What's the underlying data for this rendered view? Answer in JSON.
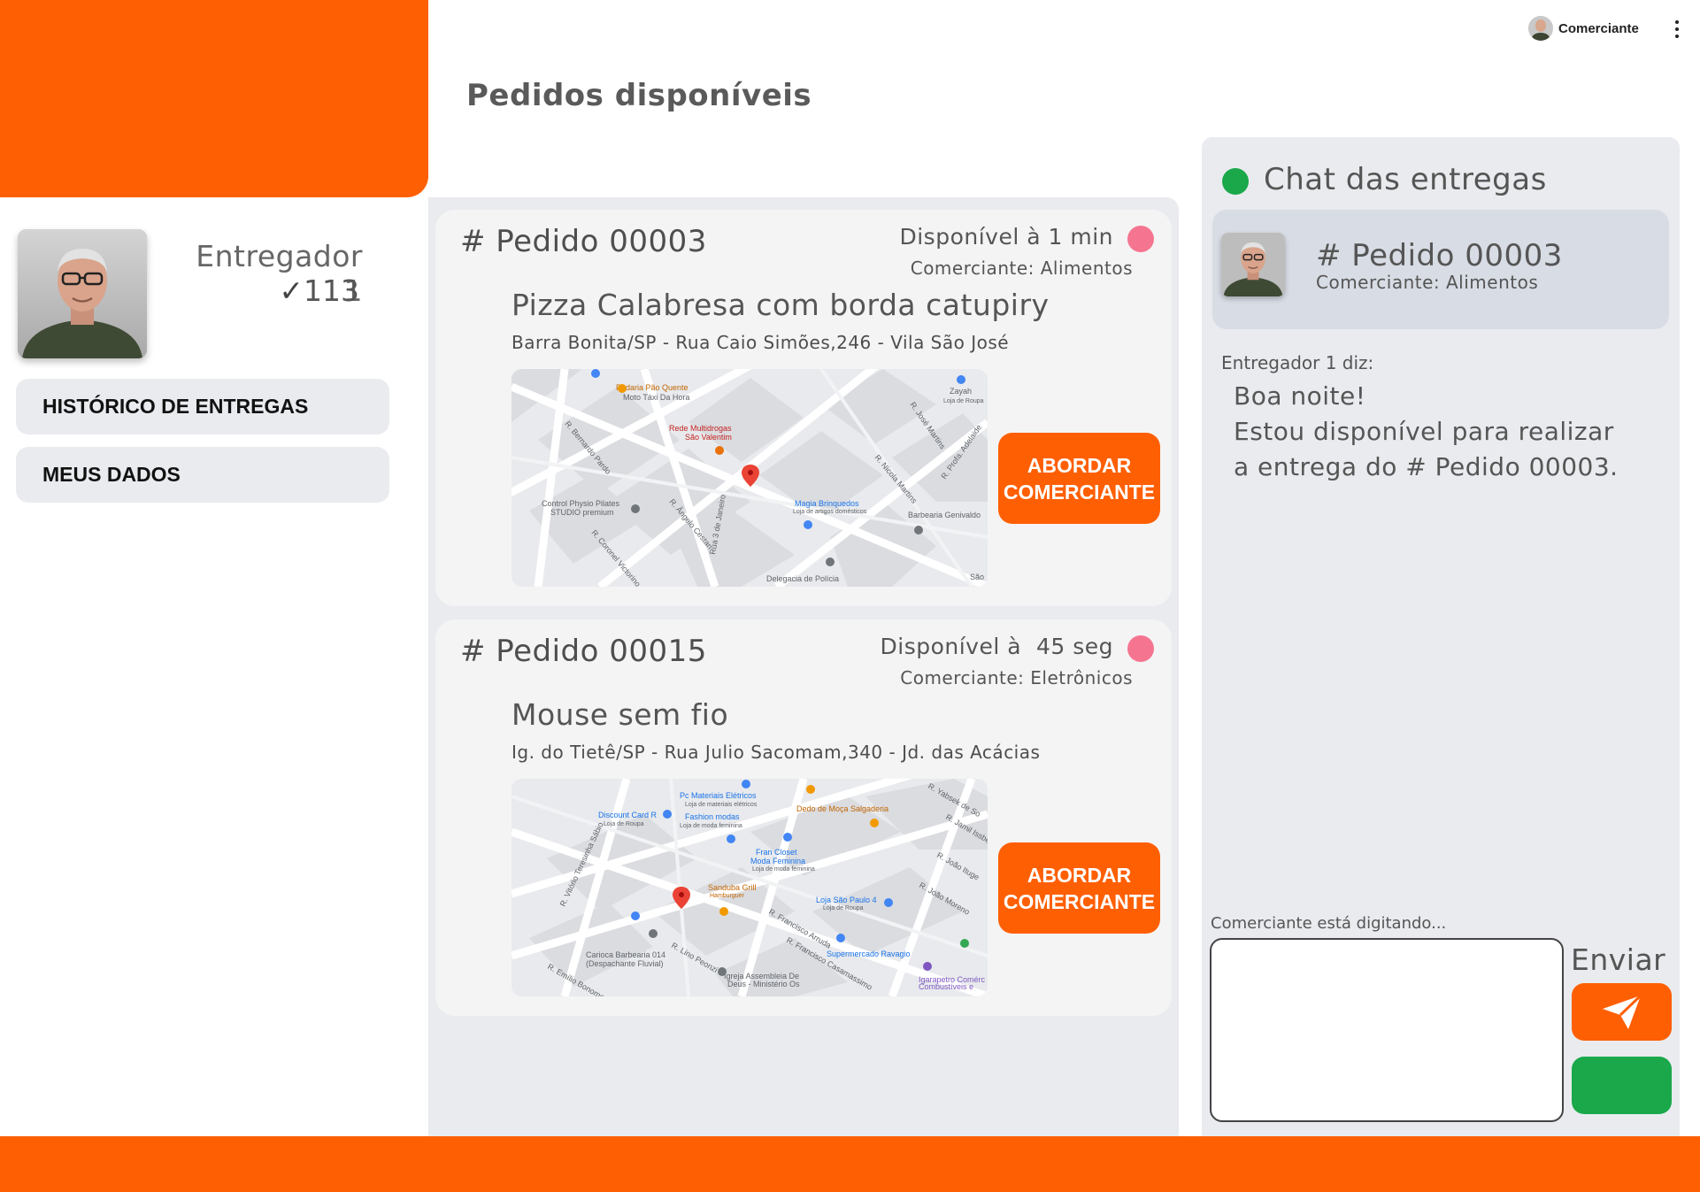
{
  "topbar": {
    "user_name": "Comerciante"
  },
  "page": {
    "title": "Pedidos disponíveis"
  },
  "profile": {
    "name": "Entregador 1",
    "deliveries_check": "✓",
    "deliveries_count": "113"
  },
  "sidebar": {
    "items": [
      {
        "label": "HISTÓRICO DE ENTREGAS"
      },
      {
        "label": "MEUS DADOS"
      }
    ]
  },
  "orders": [
    {
      "number": "# Pedido 00003",
      "available": "Disponível à 1 min",
      "merchant": "Comerciante: Alimentos",
      "product": "Pizza Calabresa com borda catupiry",
      "address": "Barra Bonita/SP - Rua Caio Simões,246 - Vila São José",
      "button_line1": "ABORDAR",
      "button_line2": "COMERCIANTE",
      "map": {
        "places": [
          "Padaria Pão Quente",
          "Moto Táxi Da Hora",
          "Rede Multidrogas",
          "São Valentim",
          "Zayah",
          "Loja de Roupa",
          "R. Bernardo Pardo",
          "R. José Martins",
          "R. Nicola Martins",
          "R. Profa. Adelaide",
          "Control Physio Pilates",
          "STUDIO premium",
          "R. Ângelo Cestari",
          "Magia Brinquedos",
          "Loja de artigos domésticos",
          "Barbearia Genivaldo",
          "R. Coronel Victorino",
          "Rua 3 de Janeiro",
          "Delegacia de Polícia",
          "São"
        ]
      }
    },
    {
      "number": "# Pedido 00015",
      "available": "Disponível à  45 seg",
      "merchant": "Comerciante: Eletrônicos",
      "product": "Mouse sem fio",
      "address": "Ig. do Tietê/SP - Rua Julio Sacomam,340 - Jd. das Acácias",
      "button_line1": "ABORDAR",
      "button_line2": "COMERCIANTE",
      "map": {
        "places": [
          "Pc Materiais Elétricos",
          "Loja de materiais elétricos",
          "Discount Card R",
          "Loja de Roupa",
          "Fashion modas",
          "Loja de moda feminina",
          "Dedo de Moça Salgaderia",
          "R. Yabsek de So",
          "R. Jamil Issber",
          "Fran Closet",
          "Moda Feminina",
          "R. João Ituge",
          "R. Vitório Teresinha Sábio",
          "Sanduba Grill",
          "Hamburgueria",
          "Loja São Paulo 4",
          "Loja de Roupa",
          "R. João Moreno",
          "R. Francisco Arruda",
          "R. Francisco Casamassimo",
          "Supermercado Ravagio",
          "Carioca Barbearia 014",
          "(Despachante Fluvial)",
          "R. Lino Peonzi",
          "R. Emílio Bonome",
          "Igreja Assembleia De",
          "Deus - Ministério Os",
          "Igarapetro Comérc",
          "Combustíveis e"
        ]
      }
    }
  ],
  "chat": {
    "title": "Chat das entregas",
    "order_number": "# Pedido 00003",
    "order_merchant": "Comerciante: Alimentos",
    "sender": "Entregador 1 diz:",
    "message": "Boa noite!\nEstou disponível para realizar\na entrega do # Pedido 00003.",
    "typing_status": "Comerciante está digitando...",
    "input_value": "",
    "send_label": "Enviar"
  },
  "colors": {
    "brand_orange": "#ff5f03",
    "online_green": "#1aa84a",
    "status_pink": "#f57590",
    "panel_gray": "#e9ebef"
  },
  "icons": {
    "send": "paper-plane-icon",
    "menu": "kebab-menu-icon",
    "map_pin": "map-pin-icon"
  }
}
